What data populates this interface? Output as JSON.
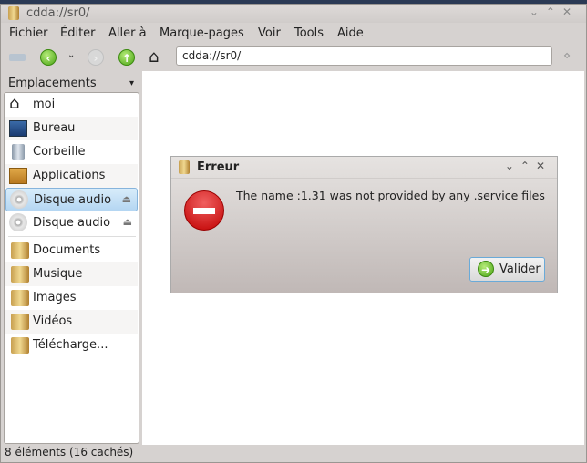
{
  "window": {
    "title": "cdda://sr0/"
  },
  "menu": [
    "Fichier",
    "Éditer",
    "Aller à",
    "Marque-pages",
    "Voir",
    "Tools",
    "Aide"
  ],
  "toolbar": {
    "address": "cdda://sr0/"
  },
  "sidebar": {
    "header": "Emplacements",
    "items": [
      {
        "label": "moi",
        "icon": "home-icon"
      },
      {
        "label": "Bureau",
        "icon": "desktop-icon"
      },
      {
        "label": "Corbeille",
        "icon": "trash-icon"
      },
      {
        "label": "Applications",
        "icon": "applications-icon"
      },
      {
        "label": "Disque audio",
        "icon": "cd-icon",
        "selected": true,
        "eject": true
      },
      {
        "label": "Disque audio",
        "icon": "cd-icon",
        "eject": true
      },
      {
        "label": "Documents",
        "icon": "folder-icon"
      },
      {
        "label": "Musique",
        "icon": "folder-icon"
      },
      {
        "label": "Images",
        "icon": "folder-icon"
      },
      {
        "label": "Vidéos",
        "icon": "folder-icon"
      },
      {
        "label": "Télécharge...",
        "icon": "folder-icon"
      }
    ]
  },
  "status": "8 éléments (16 cachés)",
  "dialog": {
    "title": "Erreur",
    "message": "The name :1.31 was not provided by any .service files",
    "button": "Valider"
  }
}
